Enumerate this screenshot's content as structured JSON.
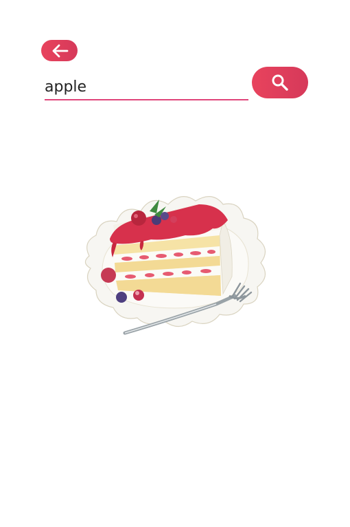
{
  "toolbar": {
    "back_icon": "arrow-left-icon",
    "search_icon": "search-icon",
    "accent_color": "#e0457b",
    "button_color": "#e13f5c"
  },
  "search": {
    "value": "apple"
  },
  "illustration": {
    "subject": "cake-slice-with-fork"
  }
}
